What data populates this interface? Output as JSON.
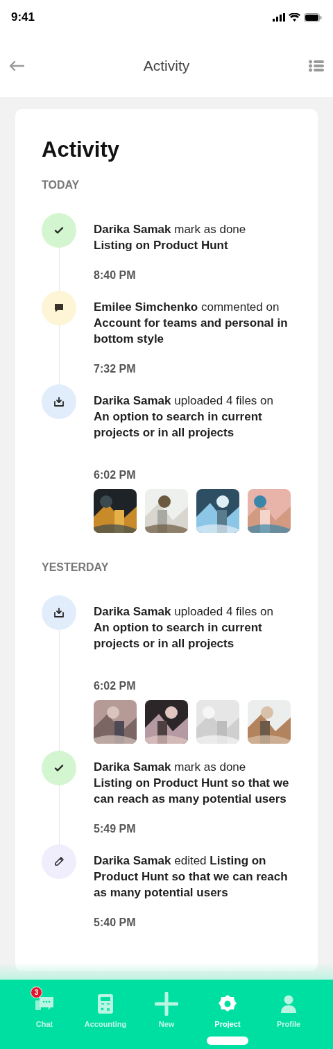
{
  "status_bar": {
    "time": "9:41"
  },
  "header": {
    "title": "Activity"
  },
  "card": {
    "title": "Activity",
    "sections": [
      {
        "label": "TODAY",
        "events": [
          {
            "kind": "done",
            "text": "**Darika Samak** mark as done\n**Listing on Product Hunt**",
            "time": "8:40 PM"
          },
          {
            "kind": "comment",
            "text": "**Emilee Simchenko** commented on\n**Account for teams and personal in bottom style**",
            "time": "7:32 PM"
          },
          {
            "kind": "upload",
            "text": "**Darika Samak** uploaded 4 files on\n**An option to search in current projects or in all projects**",
            "time": "6:02 PM"
          }
        ]
      },
      {
        "label": "YESTERDAY",
        "events": [
          {
            "kind": "upload",
            "text": "**Darika Samak** uploaded 4 files on\n**An option to search in current projects or in all projects**",
            "time": "6:02 PM"
          },
          {
            "kind": "done",
            "text": "**Darika Samak** mark as done\n**Listing on Product Hunt so that we can reach as many potential users**",
            "time": "5:49 PM"
          },
          {
            "kind": "edit",
            "text": "**Darika Samak** edited **Listing on Product Hunt so that we can reach as many potential users**",
            "time": "5:40 PM"
          }
        ]
      }
    ]
  },
  "nav": [
    {
      "label": "Chat",
      "badge": "3",
      "selected": false
    },
    {
      "label": "Accounting",
      "selected": false
    },
    {
      "label": "New",
      "selected": false
    },
    {
      "label": "Project",
      "selected": true
    },
    {
      "label": "Profile",
      "selected": false
    }
  ]
}
